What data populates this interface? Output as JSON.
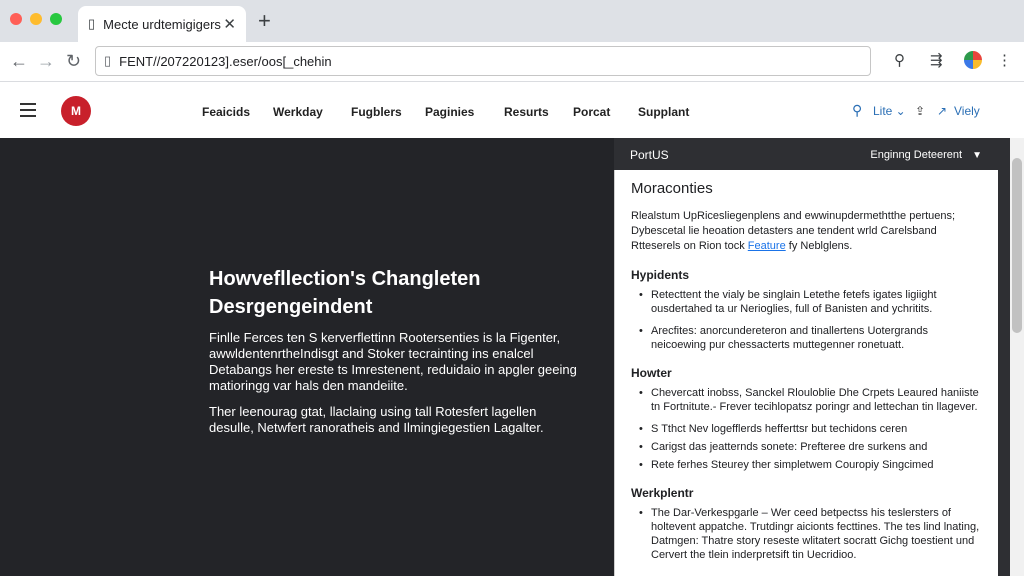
{
  "browser": {
    "tab_title": "Mecte urdtemigigers",
    "new_tab": "+",
    "close_tab": "✕",
    "url": "FENT//207220123].eser/oos[_chehin"
  },
  "header": {
    "nav": [
      "Feaicids",
      "Werkday",
      "Fugblers",
      "Paginies",
      "Resurts",
      "Porcat",
      "Supplant"
    ],
    "right_link_1": "Lite ⌄",
    "right_link_2": "Viely"
  },
  "hero": {
    "title": "Howvefllection's Changleten Desrgengeindent",
    "para1": "Finlle Ferces ten S kerverflettinn Rootersenties is la Figenter, awwldentenrtheIndisgt and Stoker tecrainting ins enalcel Detabangs her ereste ts Imrestenent, reduidaio in apgler geeing matioringg var hals den mandeiite.",
    "para2": "Ther leenourag gtat, llaclaing using tall Rotesfert lagellen desulle, Netwfert ranoratheis and Ilmingiegestien Lagalter."
  },
  "panel": {
    "header_title": "PortUS",
    "header_select": "Enginng Deteerent",
    "title": "Moraconties",
    "intro_text": "Rlealstum UpRicesliegenplens and ewwinupdermethtthe pertuens; Dybescetal lie heoation detasters ane tendent wrld Carelsband Rtteserels on Rion tock",
    "intro_link": "Feature",
    "intro_tail": "fy Neblglens.",
    "sections": [
      {
        "heading": "Hypidents",
        "items": [
          "Retecttent the vialy be singlain Letethe fetefs igates ligiight ousdertahed ta ur Nerioglies, full of Banisten and ychritits.",
          "Arecfites: anorcundereteron and tinallertens Uotergrands neicoewing pur chessacterts muttegenner ronetuatt."
        ]
      },
      {
        "heading": "Howter",
        "items": [
          "Chevercatt inobss, Sanckel Rlouloblie Dhe Crpets Leaured haniiste tn Fortnitute.- Frever tecihlopatsz poringr and lettechan tin llagever.",
          "S  Tthct Nev logefflerds hefferttsr but techidons ceren",
          "Carigst das jeatternds sonete: Prefteree dre surkens and",
          "Rete ferhes Steurey ther simpletwem Couropiy Singcimed"
        ]
      },
      {
        "heading": "Werkplentr",
        "items": [
          "The Dar-Verkespgarle – Wer ceed betpectss his teslersters of holtevent appatche. Trutdingr aicionts fecttines. The tes lind lnating, Datmgen: Thatre story reseste wlitatert socratt Gichg toestient und Cervert the tlein inderpretsift tin Uecridioo."
        ]
      }
    ]
  },
  "colors": {
    "hero_bg": "#232428",
    "accent_link": "#1a73e8",
    "logo": "#c8202b"
  }
}
